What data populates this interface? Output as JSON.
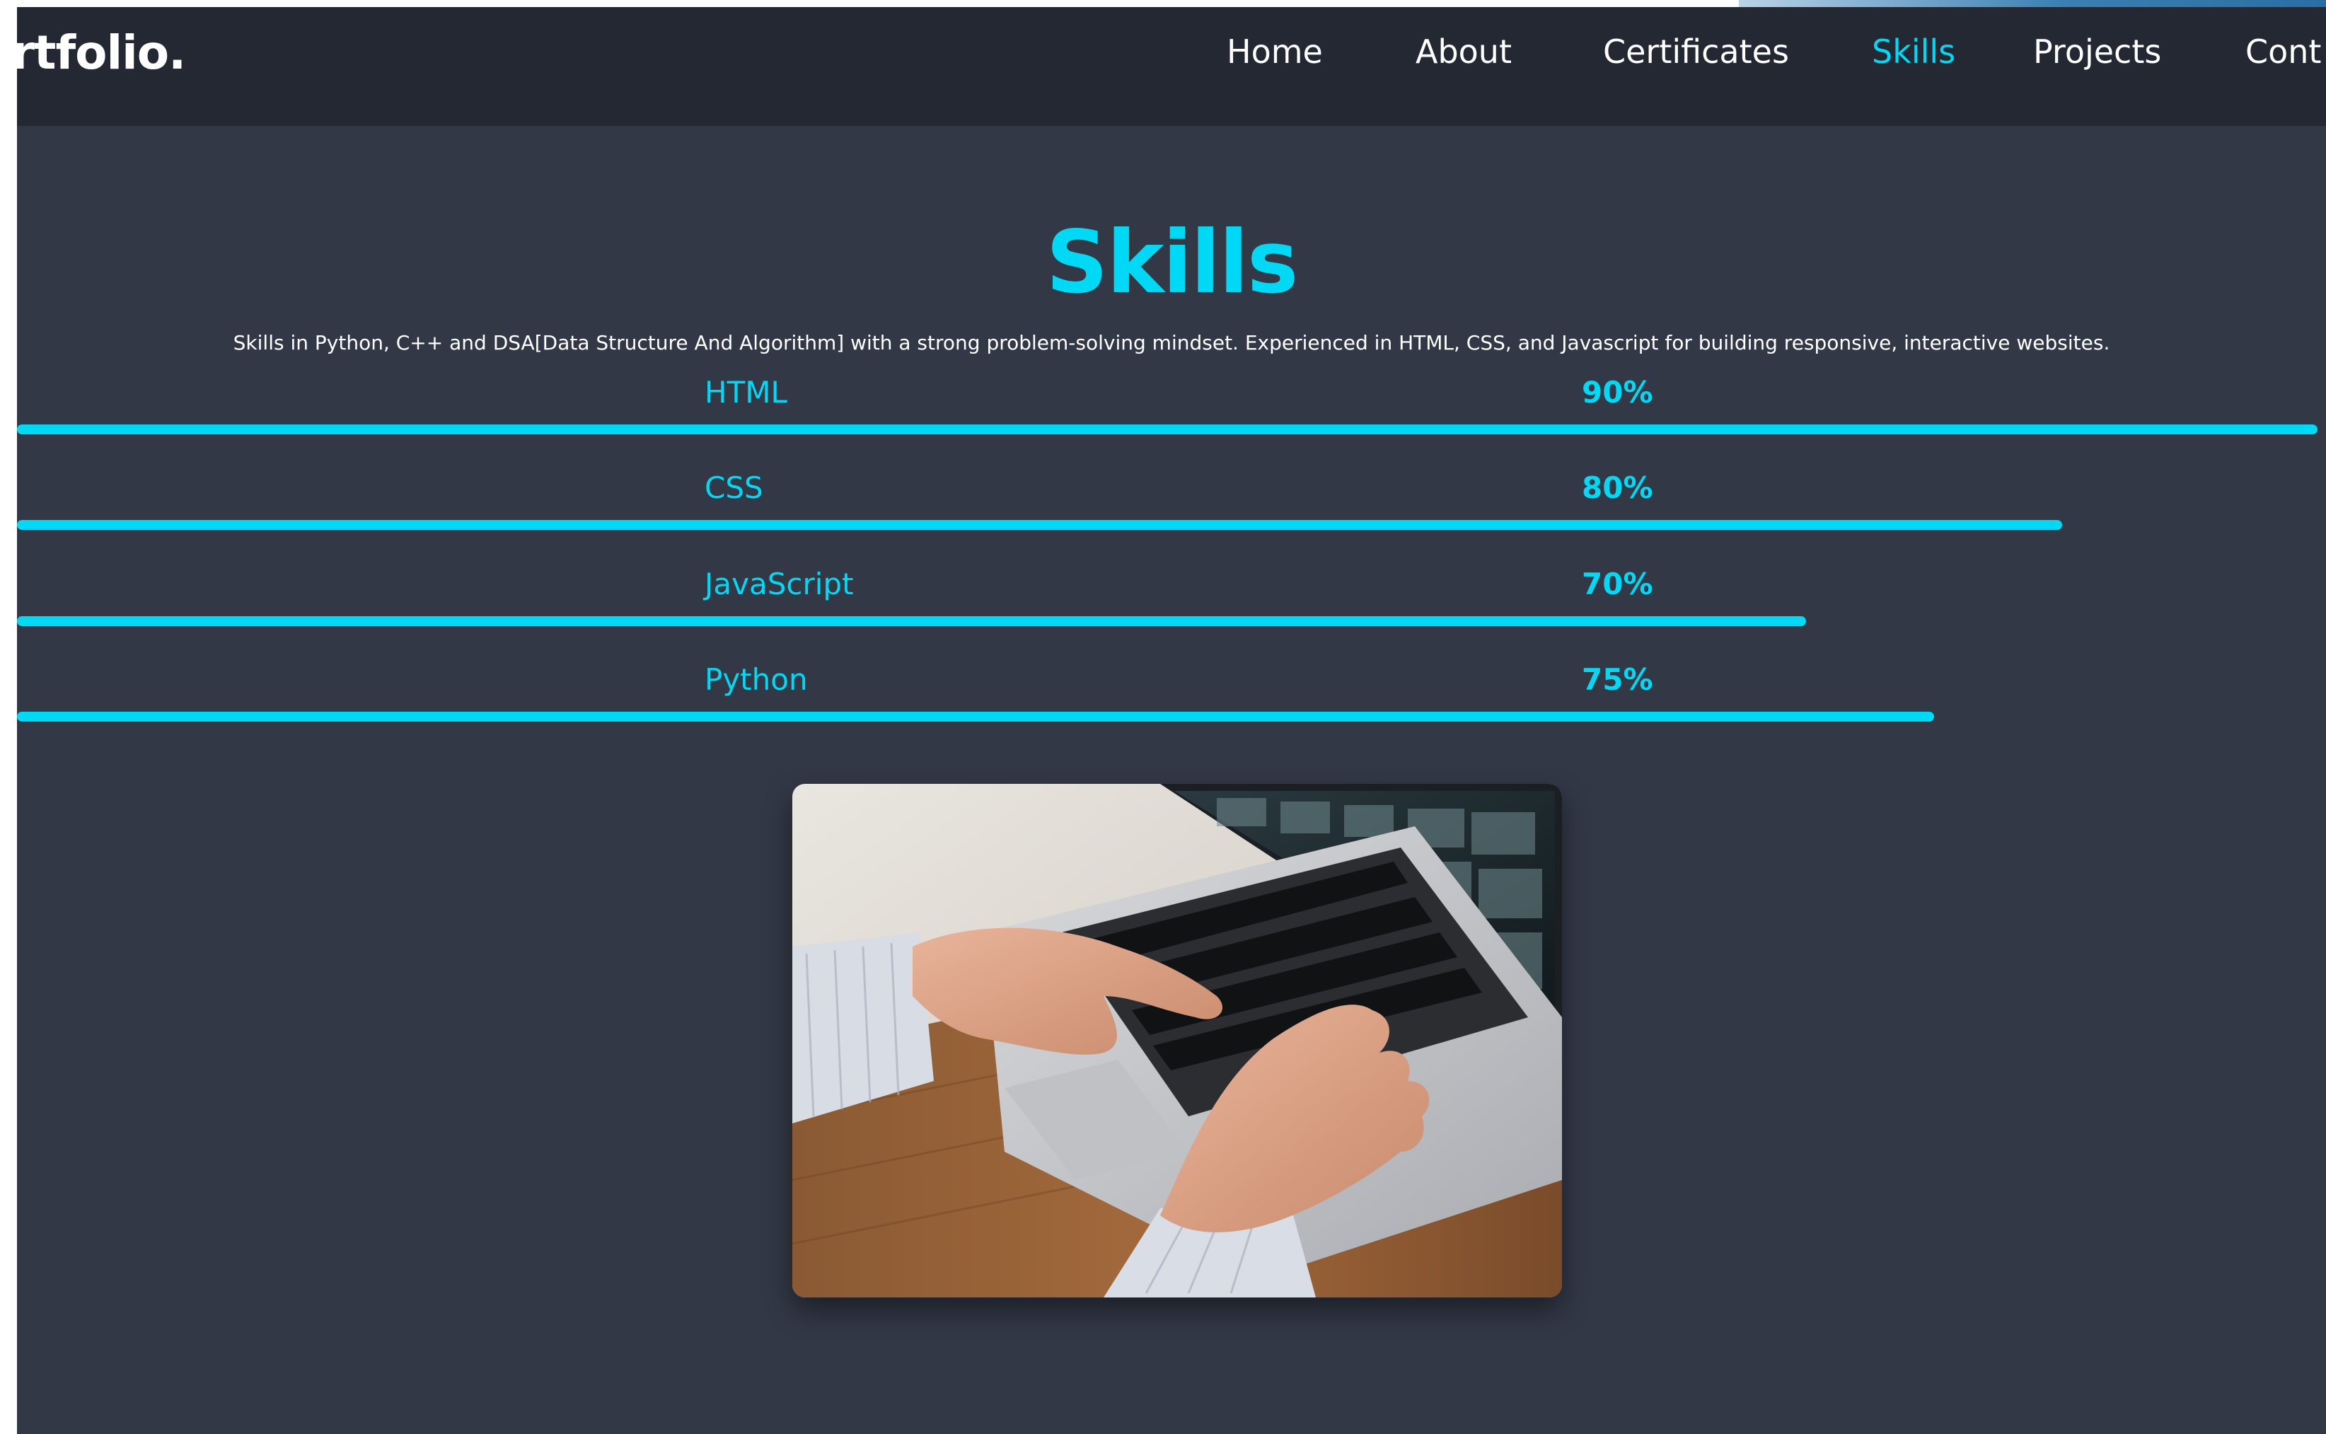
{
  "brand": {
    "logo_text": "ortfolio."
  },
  "nav": {
    "items": [
      {
        "label": "Home",
        "active": false
      },
      {
        "label": "About",
        "active": false
      },
      {
        "label": "Certificates",
        "active": false
      },
      {
        "label": "Skills",
        "active": true
      },
      {
        "label": "Projects",
        "active": false
      },
      {
        "label": "Cont",
        "active": false
      }
    ]
  },
  "skills_section": {
    "title": "Skills",
    "description": "Skills in Python, C++ and DSA[Data Structure And Algorithm] with a strong problem-solving mindset. Experienced in HTML, CSS, and Javascript for building responsive, interactive websites.",
    "skills": [
      {
        "name": "HTML",
        "percent_label": "90%",
        "level": 0.9
      },
      {
        "name": "CSS",
        "percent_label": "80%",
        "level": 0.8
      },
      {
        "name": "JavaScript",
        "percent_label": "70%",
        "level": 0.7
      },
      {
        "name": "Python",
        "percent_label": "75%",
        "level": 0.75
      }
    ],
    "image": {
      "subject": "hands typing on a laptop at a wooden desk"
    }
  },
  "colors": {
    "page_bg": "#323846",
    "navbar_bg": "#242832",
    "accent": "#00d9f5",
    "text": "#ffffff"
  },
  "icons": [
    "laptop-photo"
  ]
}
